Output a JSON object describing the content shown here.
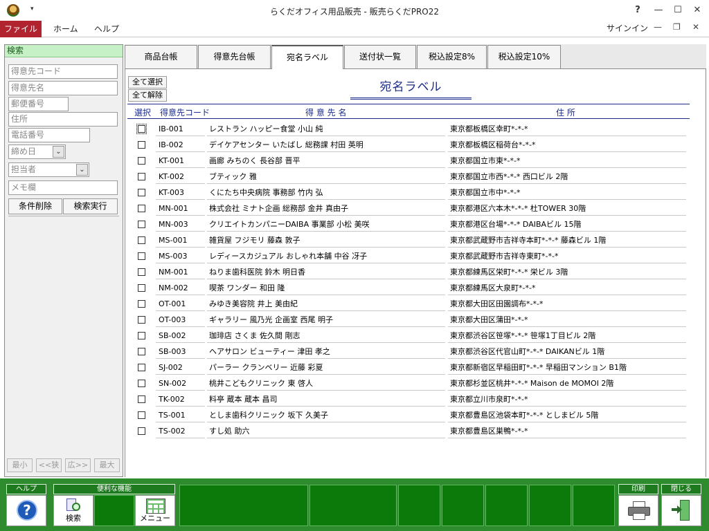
{
  "window": {
    "title": "らくだオフィス用品販売 - 販売らくだPRO22",
    "help_symbol": "?",
    "minimize_symbol": "—",
    "maximize_symbol": "☐",
    "close_symbol": "✕",
    "quick_access_symbol": "▾"
  },
  "ribbon": {
    "file": "ファイル",
    "home": "ホーム",
    "help": "ヘルプ",
    "signin": "サインイン",
    "minimize_symbol": "—",
    "restore_symbol": "❐",
    "close_symbol": "✕"
  },
  "search_pane": {
    "title": "検索",
    "customer_code_placeholder": "得意先コード",
    "customer_name_placeholder": "得意先名",
    "postal_placeholder": "郵便番号",
    "address_placeholder": "住所",
    "phone_placeholder": "電話番号",
    "closing_day": "締め日",
    "person_in_charge": "担当者",
    "memo_placeholder": "メモ欄",
    "clear_button": "条件削除",
    "search_button": "検索実行",
    "nav_min": "最小",
    "nav_narrow": "<<狭",
    "nav_wide": "広>>",
    "nav_max": "最大",
    "combo_arrow": "⌄"
  },
  "tabs": [
    "商品台帳",
    "得意先台帳",
    "宛名ラベル",
    "送付状一覧",
    "税込設定8%",
    "税込設定10%"
  ],
  "main": {
    "select_all": "全て選択",
    "deselect_all": "全て解除",
    "page_title": "宛名ラベル",
    "col_select": "選択",
    "col_code": "得意先コード",
    "col_name": "得 意 先 名",
    "col_address": "住 所"
  },
  "rows": [
    {
      "code": "IB-001",
      "name": "レストラン ハッピー食堂 小山 純",
      "address": "東京都板橋区幸町*-*-*"
    },
    {
      "code": "IB-002",
      "name": "デイケアセンター いたばし 総務課 村田 英明",
      "address": "東京都板橋区稲荷台*-*-*"
    },
    {
      "code": "KT-001",
      "name": "画廊 みちのく 長谷部 晋平",
      "address": "東京都国立市東*-*-*"
    },
    {
      "code": "KT-002",
      "name": "ブティック 雅",
      "address": "東京都国立市西*-*-* 西口ビル 2階"
    },
    {
      "code": "KT-003",
      "name": "くにたち中央病院 事務部 竹内 弘",
      "address": "東京都国立市中*-*-*"
    },
    {
      "code": "MN-001",
      "name": "株式会社 ミナト企画 総務部 金井 真由子",
      "address": "東京都港区六本木*-*-* 杜TOWER 30階"
    },
    {
      "code": "MN-003",
      "name": "クリエイトカンパニーDAIBA 事業部 小松 美咲",
      "address": "東京都港区台場*-*-* DAIBAビル 15階"
    },
    {
      "code": "MS-001",
      "name": "雑貨屋 フジモリ 藤森 敦子",
      "address": "東京都武蔵野市吉祥寺本町*-*-* 藤森ビル 1階"
    },
    {
      "code": "MS-003",
      "name": "レディースカジュアル おしゃれ本舗 中谷 冴子",
      "address": "東京都武蔵野市吉祥寺東町*-*-*"
    },
    {
      "code": "NM-001",
      "name": "ねりま歯科医院 鈴木 明日香",
      "address": "東京都練馬区栄町*-*-* 栄ビル 3階"
    },
    {
      "code": "NM-002",
      "name": "喫茶 ワンダー 和田 隆",
      "address": "東京都練馬区大泉町*-*-*"
    },
    {
      "code": "OT-001",
      "name": "みゆき美容院 井上 美由紀",
      "address": "東京都大田区田園調布*-*-*"
    },
    {
      "code": "OT-003",
      "name": "ギャラリー 風乃光 企画室 西尾 明子",
      "address": "東京都大田区蒲田*-*-*"
    },
    {
      "code": "SB-002",
      "name": "珈琲店 さくま 佐久間 剛志",
      "address": "東京都渋谷区笹塚*-*-* 笹塚1丁目ビル 2階"
    },
    {
      "code": "SB-003",
      "name": "ヘアサロン ビューティー 津田 孝之",
      "address": "東京都渋谷区代官山町*-*-* DAIKANビル 1階"
    },
    {
      "code": "SJ-002",
      "name": "パーラー クランベリー 近藤 彩夏",
      "address": "東京都新宿区早稲田町*-*-* 早稲田マンション B1階"
    },
    {
      "code": "SN-002",
      "name": "桃井こどもクリニック 東 啓人",
      "address": "東京都杉並区桃井*-*-* Maison de MOMOI 2階"
    },
    {
      "code": "TK-002",
      "name": "料亭 蔵本 蔵本 昌司",
      "address": "東京都立川市泉町*-*-*"
    },
    {
      "code": "TS-001",
      "name": "としま歯科クリニック 坂下 久美子",
      "address": "東京都豊島区池袋本町*-*-* としまビル 5階"
    },
    {
      "code": "TS-002",
      "name": "すし処 助六",
      "address": "東京都豊島区巣鴨*-*-*"
    }
  ],
  "footer": {
    "help_caption": "ヘルプ",
    "tools_caption": "便利な機能",
    "search_label": "検索",
    "menu_label": "メニュー",
    "print_caption": "印刷",
    "close_caption": "閉じる",
    "help_symbol": "?"
  }
}
